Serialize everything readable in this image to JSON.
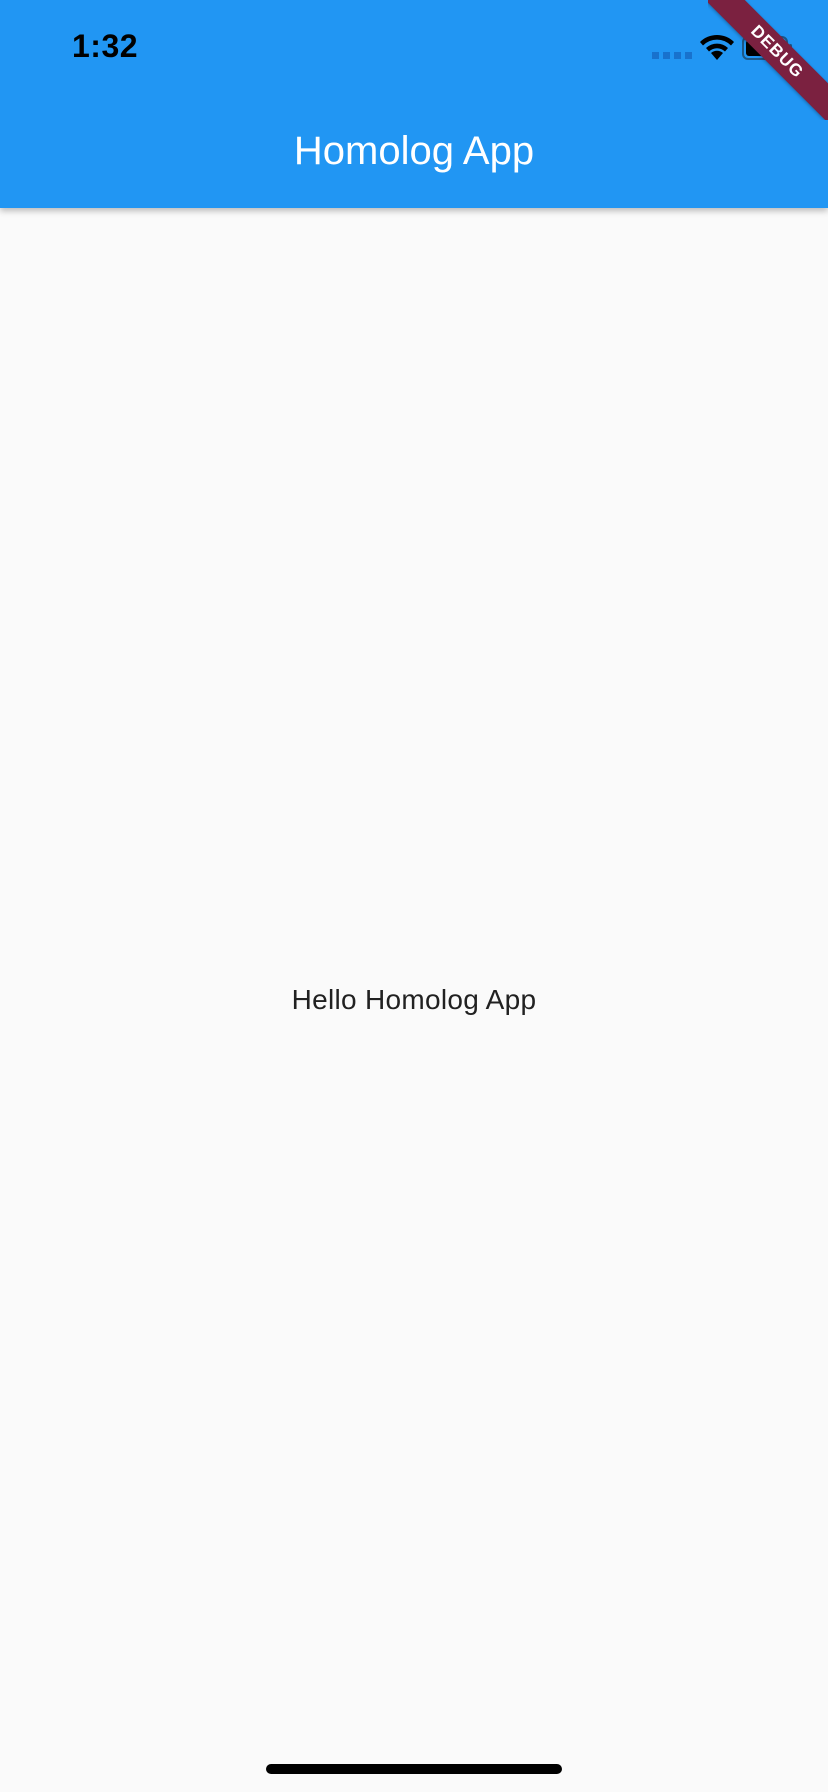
{
  "status_bar": {
    "time": "1:32",
    "icons": [
      "cellular-signal-icon",
      "wifi-icon",
      "battery-icon"
    ]
  },
  "app_bar": {
    "title": "Homolog App",
    "background_color": "#2196f3",
    "title_color": "#ffffff"
  },
  "debug_banner": {
    "label": "DEBUG",
    "color": "#7b2140"
  },
  "body": {
    "text": "Hello Homolog App",
    "background_color": "#fafafa"
  }
}
